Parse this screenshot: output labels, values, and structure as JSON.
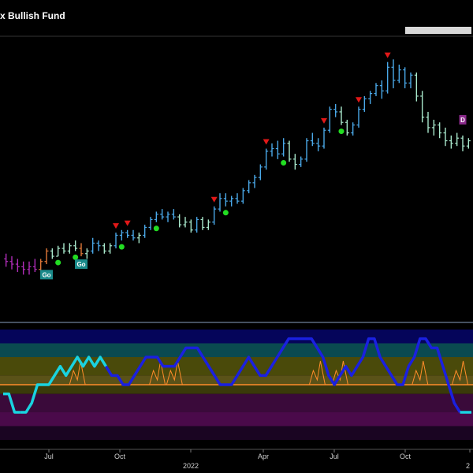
{
  "chart_data": {
    "type": "line",
    "title": "x Bullish Fund",
    "x_ticks": [
      "Jul",
      "Oct",
      "2022",
      "Apr",
      "Jul",
      "Oct",
      "2"
    ],
    "price_panel": {
      "type": "ohlc",
      "ylim": [
        0,
        100
      ],
      "bars": [
        {
          "o": 20,
          "h": 22,
          "l": 17,
          "c": 19,
          "color": "purple"
        },
        {
          "o": 19,
          "h": 21,
          "l": 16,
          "c": 18,
          "color": "purple"
        },
        {
          "o": 18,
          "h": 20,
          "l": 15,
          "c": 17,
          "color": "purple"
        },
        {
          "o": 17,
          "h": 19,
          "l": 14,
          "c": 16,
          "color": "purple"
        },
        {
          "o": 16,
          "h": 19,
          "l": 14,
          "c": 17,
          "color": "purple"
        },
        {
          "o": 17,
          "h": 20,
          "l": 15,
          "c": 16,
          "color": "purple"
        },
        {
          "o": 16,
          "h": 20,
          "l": 15,
          "c": 19,
          "color": "orange"
        },
        {
          "o": 19,
          "h": 24,
          "l": 18,
          "c": 23,
          "color": "orange"
        },
        {
          "o": 23,
          "h": 24,
          "l": 20,
          "c": 21,
          "color": "paleblue"
        },
        {
          "o": 21,
          "h": 25,
          "l": 21,
          "c": 24,
          "color": "paleblue"
        },
        {
          "o": 24,
          "h": 26,
          "l": 22,
          "c": 23,
          "color": "paleblue"
        },
        {
          "o": 23,
          "h": 26,
          "l": 22,
          "c": 25,
          "color": "paleblue"
        },
        {
          "o": 25,
          "h": 27,
          "l": 23,
          "c": 24,
          "color": "paleblue"
        },
        {
          "o": 24,
          "h": 26,
          "l": 21,
          "c": 22,
          "color": "orange"
        },
        {
          "o": 22,
          "h": 24,
          "l": 20,
          "c": 23,
          "color": "paleblue"
        },
        {
          "o": 23,
          "h": 28,
          "l": 22,
          "c": 26,
          "color": "blue"
        },
        {
          "o": 26,
          "h": 27,
          "l": 23,
          "c": 25,
          "color": "blue"
        },
        {
          "o": 25,
          "h": 26,
          "l": 22,
          "c": 23,
          "color": "paleblue"
        },
        {
          "o": 23,
          "h": 26,
          "l": 22,
          "c": 25,
          "color": "paleblue"
        },
        {
          "o": 25,
          "h": 30,
          "l": 24,
          "c": 29,
          "color": "blue"
        },
        {
          "o": 29,
          "h": 31,
          "l": 27,
          "c": 30,
          "color": "blue"
        },
        {
          "o": 30,
          "h": 31,
          "l": 28,
          "c": 29,
          "color": "blue"
        },
        {
          "o": 29,
          "h": 31,
          "l": 27,
          "c": 28,
          "color": "blue"
        },
        {
          "o": 28,
          "h": 30,
          "l": 26,
          "c": 29,
          "color": "paleblue"
        },
        {
          "o": 29,
          "h": 33,
          "l": 28,
          "c": 32,
          "color": "blue"
        },
        {
          "o": 32,
          "h": 36,
          "l": 31,
          "c": 35,
          "color": "blue"
        },
        {
          "o": 35,
          "h": 38,
          "l": 34,
          "c": 37,
          "color": "blue"
        },
        {
          "o": 37,
          "h": 39,
          "l": 35,
          "c": 36,
          "color": "blue"
        },
        {
          "o": 36,
          "h": 38,
          "l": 34,
          "c": 37,
          "color": "blue"
        },
        {
          "o": 37,
          "h": 39,
          "l": 35,
          "c": 36,
          "color": "blue"
        },
        {
          "o": 36,
          "h": 37,
          "l": 32,
          "c": 33,
          "color": "paleblue"
        },
        {
          "o": 33,
          "h": 36,
          "l": 32,
          "c": 34,
          "color": "paleblue"
        },
        {
          "o": 34,
          "h": 35,
          "l": 30,
          "c": 31,
          "color": "paleblue"
        },
        {
          "o": 31,
          "h": 36,
          "l": 30,
          "c": 35,
          "color": "blue"
        },
        {
          "o": 35,
          "h": 36,
          "l": 31,
          "c": 32,
          "color": "paleblue"
        },
        {
          "o": 32,
          "h": 35,
          "l": 31,
          "c": 34,
          "color": "paleblue"
        },
        {
          "o": 34,
          "h": 40,
          "l": 33,
          "c": 39,
          "color": "blue"
        },
        {
          "o": 39,
          "h": 45,
          "l": 38,
          "c": 43,
          "color": "blue"
        },
        {
          "o": 43,
          "h": 45,
          "l": 40,
          "c": 42,
          "color": "blue"
        },
        {
          "o": 42,
          "h": 44,
          "l": 40,
          "c": 43,
          "color": "blue"
        },
        {
          "o": 43,
          "h": 45,
          "l": 41,
          "c": 42,
          "color": "blue"
        },
        {
          "o": 42,
          "h": 47,
          "l": 41,
          "c": 46,
          "color": "blue"
        },
        {
          "o": 46,
          "h": 50,
          "l": 45,
          "c": 49,
          "color": "blue"
        },
        {
          "o": 49,
          "h": 52,
          "l": 47,
          "c": 51,
          "color": "blue"
        },
        {
          "o": 51,
          "h": 56,
          "l": 50,
          "c": 55,
          "color": "blue"
        },
        {
          "o": 55,
          "h": 62,
          "l": 54,
          "c": 61,
          "color": "blue"
        },
        {
          "o": 61,
          "h": 64,
          "l": 59,
          "c": 62,
          "color": "blue"
        },
        {
          "o": 62,
          "h": 65,
          "l": 58,
          "c": 60,
          "color": "blue"
        },
        {
          "o": 60,
          "h": 66,
          "l": 59,
          "c": 64,
          "color": "blue"
        },
        {
          "o": 64,
          "h": 65,
          "l": 57,
          "c": 58,
          "color": "paleblue"
        },
        {
          "o": 58,
          "h": 60,
          "l": 54,
          "c": 56,
          "color": "paleblue"
        },
        {
          "o": 56,
          "h": 59,
          "l": 55,
          "c": 58,
          "color": "blue"
        },
        {
          "o": 58,
          "h": 66,
          "l": 57,
          "c": 65,
          "color": "blue"
        },
        {
          "o": 65,
          "h": 68,
          "l": 63,
          "c": 64,
          "color": "blue"
        },
        {
          "o": 64,
          "h": 66,
          "l": 61,
          "c": 63,
          "color": "blue"
        },
        {
          "o": 63,
          "h": 70,
          "l": 62,
          "c": 69,
          "color": "blue"
        },
        {
          "o": 69,
          "h": 78,
          "l": 68,
          "c": 77,
          "color": "blue"
        },
        {
          "o": 77,
          "h": 79,
          "l": 74,
          "c": 76,
          "color": "blue"
        },
        {
          "o": 76,
          "h": 78,
          "l": 71,
          "c": 72,
          "color": "paleblue"
        },
        {
          "o": 72,
          "h": 73,
          "l": 67,
          "c": 68,
          "color": "paleblue"
        },
        {
          "o": 68,
          "h": 72,
          "l": 67,
          "c": 71,
          "color": "blue"
        },
        {
          "o": 71,
          "h": 78,
          "l": 70,
          "c": 77,
          "color": "blue"
        },
        {
          "o": 77,
          "h": 82,
          "l": 76,
          "c": 81,
          "color": "blue"
        },
        {
          "o": 81,
          "h": 84,
          "l": 79,
          "c": 83,
          "color": "blue"
        },
        {
          "o": 83,
          "h": 87,
          "l": 82,
          "c": 86,
          "color": "blue"
        },
        {
          "o": 86,
          "h": 88,
          "l": 81,
          "c": 84,
          "color": "blue"
        },
        {
          "o": 84,
          "h": 95,
          "l": 83,
          "c": 93,
          "color": "blue"
        },
        {
          "o": 93,
          "h": 96,
          "l": 85,
          "c": 88,
          "color": "blue"
        },
        {
          "o": 88,
          "h": 94,
          "l": 87,
          "c": 92,
          "color": "blue"
        },
        {
          "o": 92,
          "h": 93,
          "l": 85,
          "c": 87,
          "color": "blue"
        },
        {
          "o": 87,
          "h": 91,
          "l": 85,
          "c": 90,
          "color": "blue"
        },
        {
          "o": 90,
          "h": 91,
          "l": 80,
          "c": 82,
          "color": "paleblue"
        },
        {
          "o": 82,
          "h": 84,
          "l": 72,
          "c": 74,
          "color": "paleblue"
        },
        {
          "o": 74,
          "h": 76,
          "l": 68,
          "c": 70,
          "color": "paleblue"
        },
        {
          "o": 70,
          "h": 73,
          "l": 67,
          "c": 71,
          "color": "paleblue"
        },
        {
          "o": 71,
          "h": 72,
          "l": 66,
          "c": 68,
          "color": "paleblue"
        },
        {
          "o": 68,
          "h": 70,
          "l": 63,
          "c": 65,
          "color": "paleblue"
        },
        {
          "o": 65,
          "h": 67,
          "l": 62,
          "c": 64,
          "color": "paleblue"
        },
        {
          "o": 64,
          "h": 68,
          "l": 63,
          "c": 66,
          "color": "paleblue"
        },
        {
          "o": 66,
          "h": 67,
          "l": 61,
          "c": 63,
          "color": "paleblue"
        },
        {
          "o": 63,
          "h": 66,
          "l": 62,
          "c": 65,
          "color": "paleblue"
        }
      ],
      "bar_colors": {
        "purple": "#b02db8",
        "orange": "#e07838",
        "paleblue": "#a8e8cc",
        "blue": "#4aa8e8"
      },
      "peak_markers": [
        19,
        21,
        36,
        45,
        55,
        61,
        66
      ],
      "trough_markers": [
        9,
        12,
        20,
        26,
        38,
        48,
        58
      ],
      "badges": [
        {
          "text": "Go",
          "index": 7,
          "value": 14
        },
        {
          "text": "Go",
          "index": 13,
          "value": 18
        },
        {
          "text": "D",
          "index": 79,
          "value": 73
        }
      ],
      "marker_colors": {
        "peak": "#e21818",
        "trough": "#22dd22"
      }
    },
    "oscillator_panel": {
      "ylim": [
        -6,
        6
      ],
      "zero_line": 0,
      "zero_line_color": "#ff8c2a",
      "values": [
        -1,
        -1,
        -3,
        -3,
        -3,
        -2,
        0,
        0,
        0,
        1,
        2,
        1,
        2,
        3,
        2,
        3,
        2,
        3,
        2,
        1,
        1,
        0,
        0,
        1,
        2,
        3,
        3,
        3,
        2,
        2,
        2,
        3,
        4,
        4,
        4,
        3,
        2,
        1,
        0,
        0,
        0,
        1,
        2,
        3,
        2,
        1,
        1,
        2,
        3,
        4,
        5,
        5,
        5,
        5,
        5,
        4,
        3,
        1,
        0,
        1,
        2,
        1,
        2,
        3,
        5,
        5,
        3,
        2,
        1,
        0,
        0,
        2,
        3,
        5,
        5,
        4,
        4,
        2,
        0,
        -2,
        -3,
        -3,
        -3
      ],
      "segments": [
        {
          "from": 0,
          "to": 3,
          "color": "cyan"
        },
        {
          "from": 3,
          "to": 18,
          "color": "cyan"
        },
        {
          "from": 18,
          "to": 80,
          "color": "blue"
        },
        {
          "from": 80,
          "to": 82,
          "color": "cyan"
        }
      ],
      "segment_colors": {
        "cyan": "#19d3e0",
        "blue": "#1a20e0"
      },
      "bands": [
        {
          "from": 4.5,
          "to": 6,
          "color": "#05055a"
        },
        {
          "from": 3,
          "to": 4.5,
          "color": "#0a4a50"
        },
        {
          "from": 1,
          "to": 3,
          "color": "#4a4a0a"
        },
        {
          "from": 0,
          "to": 1,
          "color": "#5a5218"
        },
        {
          "from": -1,
          "to": 0,
          "color": "#3a3a0a"
        },
        {
          "from": -3,
          "to": -1,
          "color": "#3a0a3a"
        },
        {
          "from": -4.5,
          "to": -3,
          "color": "#4a0a4a"
        },
        {
          "from": -6,
          "to": -4.5,
          "color": "#1a0522"
        }
      ],
      "spike_markers": [
        13,
        27,
        30,
        55,
        59,
        73,
        80
      ],
      "spike_color": "#ff8c2a"
    }
  }
}
